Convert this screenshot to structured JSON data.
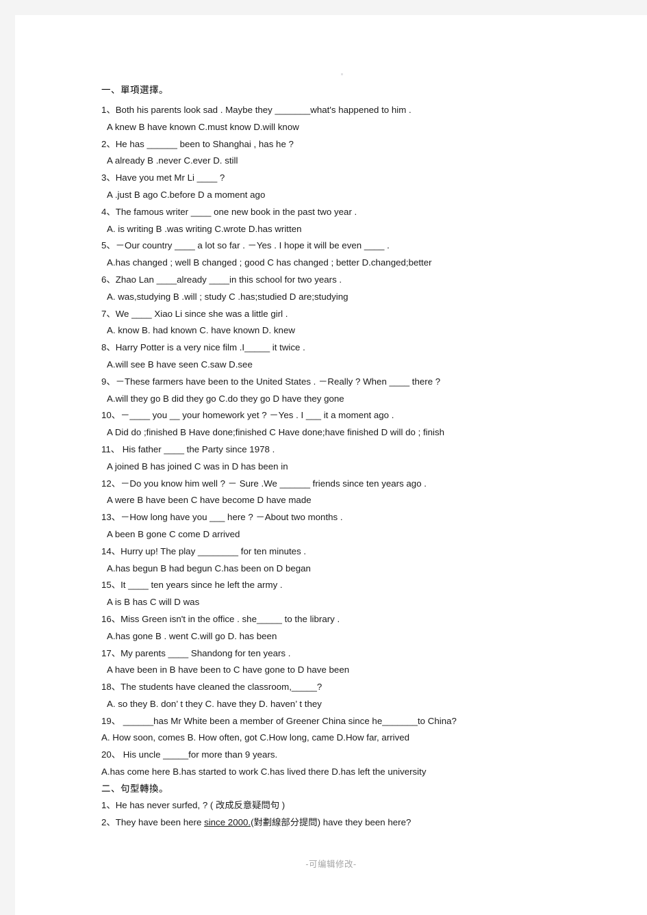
{
  "document": {
    "section_one": {
      "heading": "一、單項選擇。",
      "questions": [
        {
          "stem": "1、Both  his   parents   look   sad . Maybe   they   _______what's   happened   to   him .",
          "options": "A knew       B have known       C.must know        D.will know"
        },
        {
          "stem": "2、He  has  ______ been  to  Shanghai , has  he ?",
          "options": "A already          B .never        C.ever         D. still"
        },
        {
          "stem": "3、Have  you  met  Mr  Li ____ ?",
          "options": "A .just           B ago          C.before        D a moment ago"
        },
        {
          "stem": "4、The famous writer ____ one new book in the past two year .",
          "options": "A. is  writing     B .was  writing        C.wrote      D.has  written"
        },
        {
          "stem": "5、－Our country  ____ a lot so far . －Yes . I hope it will be even ____ .",
          "options": "A.has changed ; well       B changed ; good      C has changed ; better     D.changed;better"
        },
        {
          "stem": "6、Zhao Lan ____already   ____in this school for two years .",
          "options": "A. was,studying      B .will ; study   C .has;studied      D are;studying"
        },
        {
          "stem": "7、We ____ Xiao  Li  since  she  was  a  little  girl .",
          "options": "A. know        B.  had   known       C. have  known       D.  knew"
        },
        {
          "stem": "8、Harry Potter is a very nice film .I_____ it twice .",
          "options": "A.will see       B have seen      C.saw     D.see"
        },
        {
          "stem": "9、－These  farmers  have  been  to  the  United  States . －Really ? When ____   there ?",
          "options": "A.will they go   B did they go    C.do they go       D have they gone"
        },
        {
          "stem": "10、－____ you __ your  homework  yet ? －Yes . I ___  it  a  moment  ago .",
          "options": "A Did do ;finished       B Have done;finished      C Have done;have finished    D will do ; finish"
        },
        {
          "stem": "11、  His father ____ the Party since 1978 .",
          "options": "A joined     B has joined      C was in     D has been in"
        },
        {
          "stem": "12、－Do you know him well ? －  Sure .We ______ friends since ten years ago .",
          "options": "A were     B have been       C have become        D have made"
        },
        {
          "stem": "13、－How long have you  ___ here ? －About two months .",
          "options": "A been     B gone     C come     D arrived"
        },
        {
          "stem": "14、Hurry  up! The  play ________ for  ten  minutes .",
          "options": "A.has begun    B had  begun   C.has  been  on   D began"
        },
        {
          "stem": "15、It  ____ ten  years  since  he  left  the  army .",
          "options": "A is     B has       C will      D was"
        },
        {
          "stem": "16、Miss  Green  isn't  in  the  office . she_____  to  the  library .",
          "options": "A.has  gone     B . went          C.will  go          D.  has  been"
        },
        {
          "stem": "17、My  parents ____   Shandong  for  ten  years .",
          "options": "A have been in      B have been to   C have gone to     D have been"
        },
        {
          "stem": "18、The students have cleaned the classroom,_____?",
          "options": "A. so they     B. don’ t they     C. have they      D. haven’ t they"
        },
        {
          "stem": "19、 ______has Mr White been a member of Greener China since he_______to China?",
          "options": "A. How soon, comes     B. How often, got   C.How long, came    D.How far, arrived"
        },
        {
          "stem": "20、  His uncle _____for more than 9 years.",
          "options": "A.has come here     B.has started to work    C.has lived there    D.has left the university"
        }
      ]
    },
    "section_two": {
      "heading": "二、句型轉換。",
      "q1_pre": "1、He has never surfed, ",
      "q1_blank": "              ",
      "q1_post": "? ( 改成反意疑問句 )",
      "q2_pre": "2、They have been here ",
      "q2_underlined": "since 2000.",
      "q2_paren": "(對劃線部分提問)",
      "q2_blank1": "        ",
      "q2_blank2": "        ",
      "q2_post": " have they been here?"
    }
  },
  "footer": {
    "text": "-可编辑修改-"
  }
}
